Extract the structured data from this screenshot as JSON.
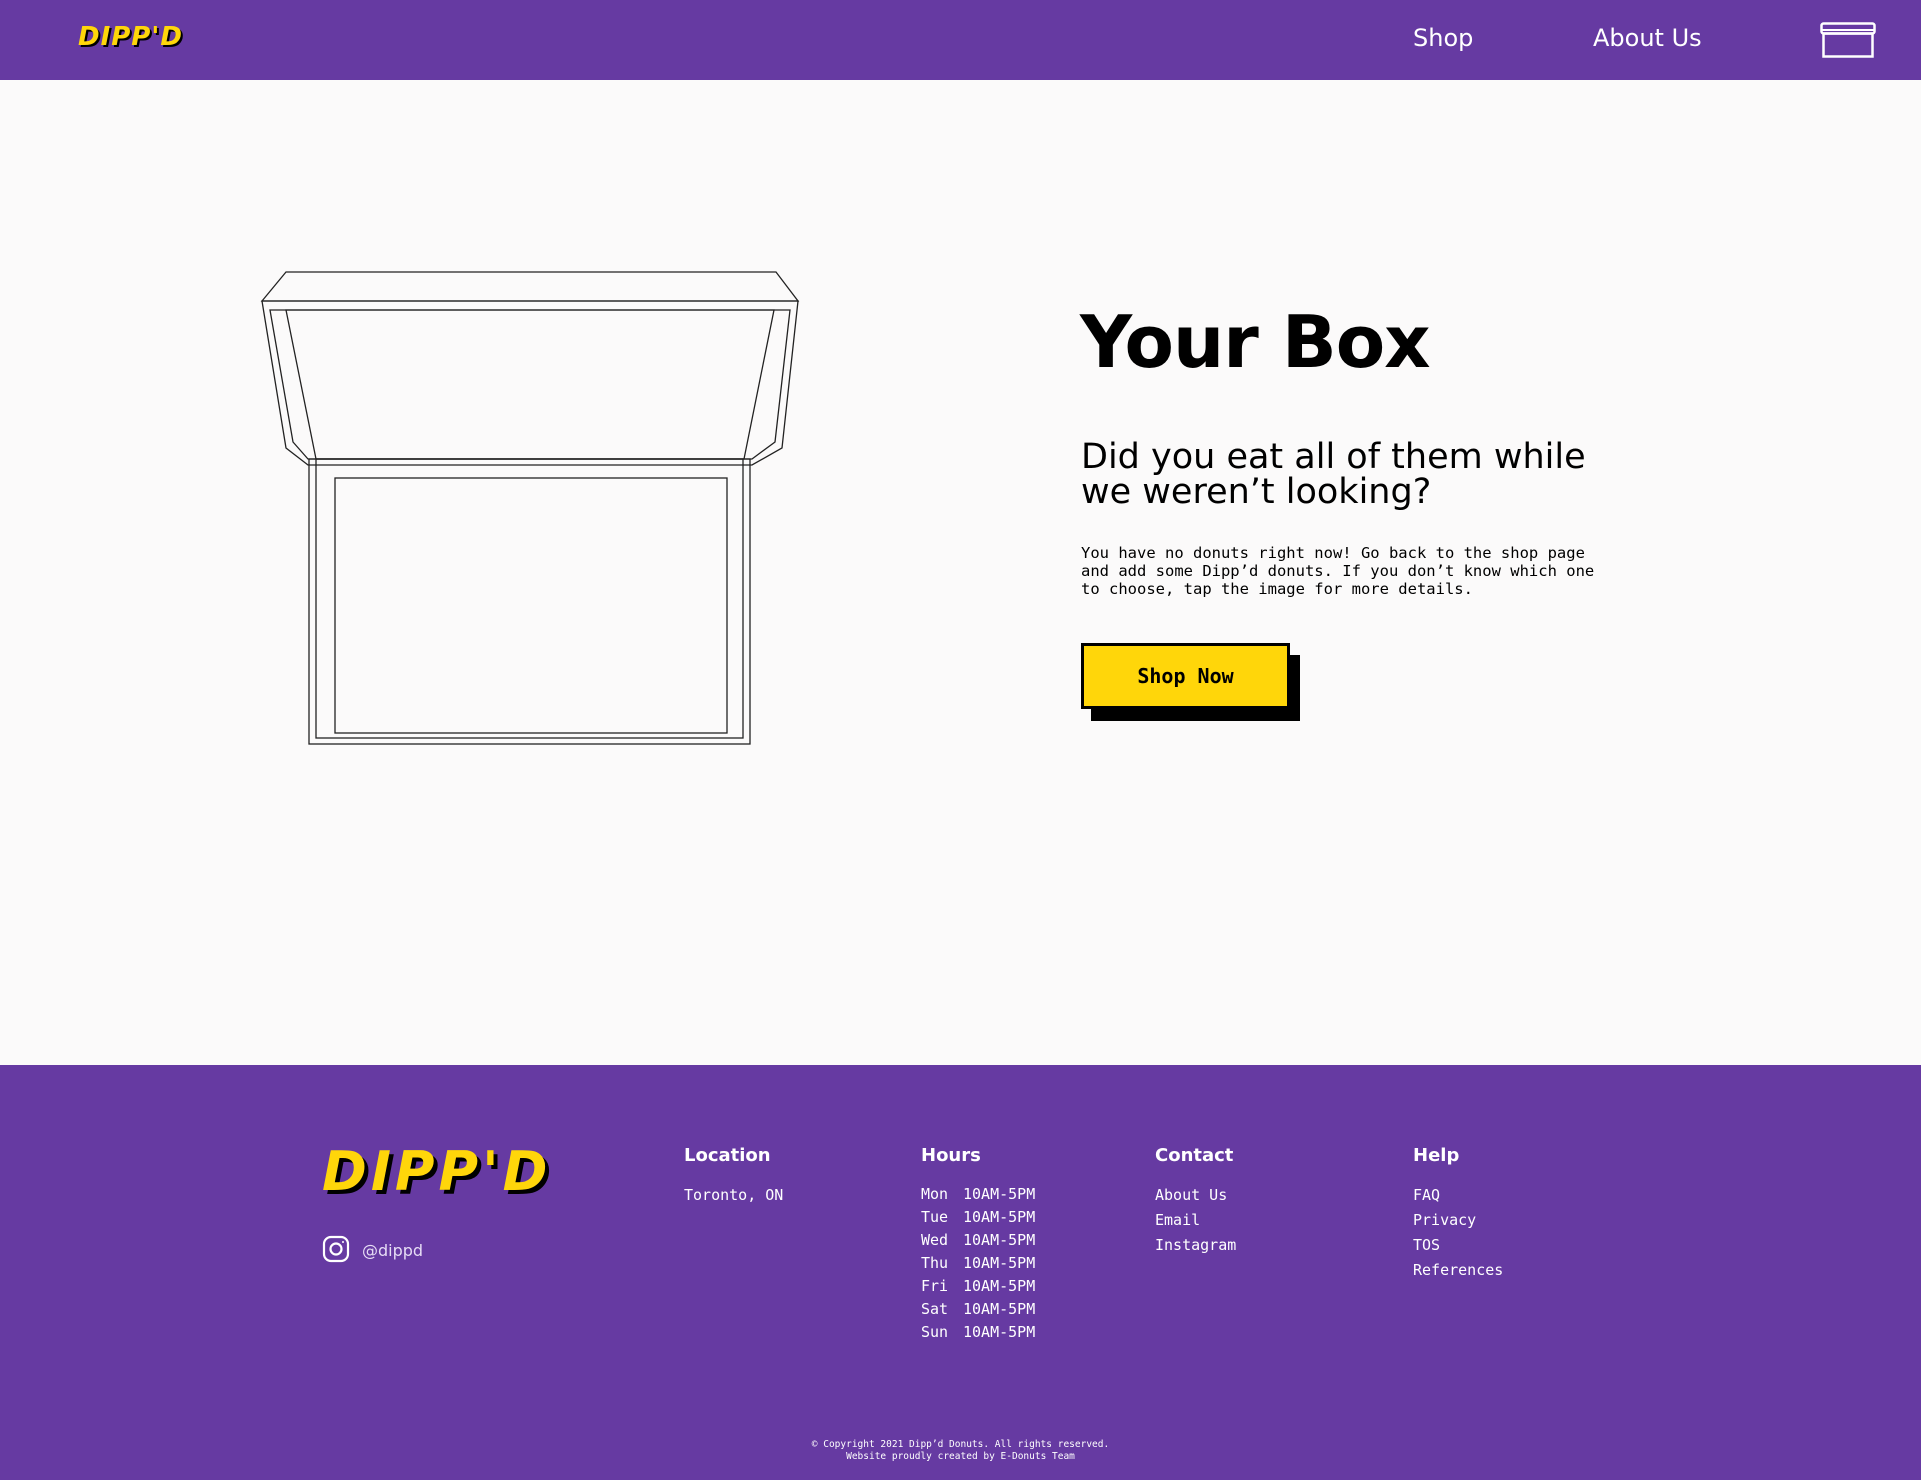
{
  "header": {
    "logo": "DIPP'D",
    "nav": [
      {
        "label": "Shop"
      },
      {
        "label": "About Us"
      }
    ],
    "box_icon": "box-icon"
  },
  "hero": {
    "title": "Your Box",
    "subtitle": "Did you eat all of them while we weren’t looking?",
    "description": "You have no donuts right now! Go back to the shop page and add some Dipp’d donuts. If you don’t know which one to choose, tap the image for more details.",
    "button_label": "Shop Now",
    "illustration": "empty-donut-box-outline"
  },
  "footer": {
    "logo": "DIPP'D",
    "instagram_icon": "instagram-icon",
    "instagram_handle": "@dippd",
    "location": {
      "heading": "Location",
      "value": "Toronto, ON"
    },
    "hours": {
      "heading": "Hours",
      "rows": [
        {
          "day": "Mon",
          "time": "10AM-5PM"
        },
        {
          "day": "Tue",
          "time": "10AM-5PM"
        },
        {
          "day": "Wed",
          "time": "10AM-5PM"
        },
        {
          "day": "Thu",
          "time": "10AM-5PM"
        },
        {
          "day": "Fri",
          "time": "10AM-5PM"
        },
        {
          "day": "Sat",
          "time": "10AM-5PM"
        },
        {
          "day": "Sun",
          "time": "10AM-5PM"
        }
      ]
    },
    "contact": {
      "heading": "Contact",
      "links": [
        "About Us",
        "Email",
        "Instagram"
      ]
    },
    "help": {
      "heading": "Help",
      "links": [
        "FAQ",
        "Privacy",
        "TOS",
        "References"
      ]
    },
    "copyright_line1": "© Copyright 2021 Dipp’d Donuts. All rights reserved.",
    "copyright_line2": "Website proudly created by E-Donuts Team"
  },
  "colors": {
    "brand_purple": "#663aa2",
    "brand_yellow": "#ffd60a",
    "background": "#fbfafa"
  }
}
